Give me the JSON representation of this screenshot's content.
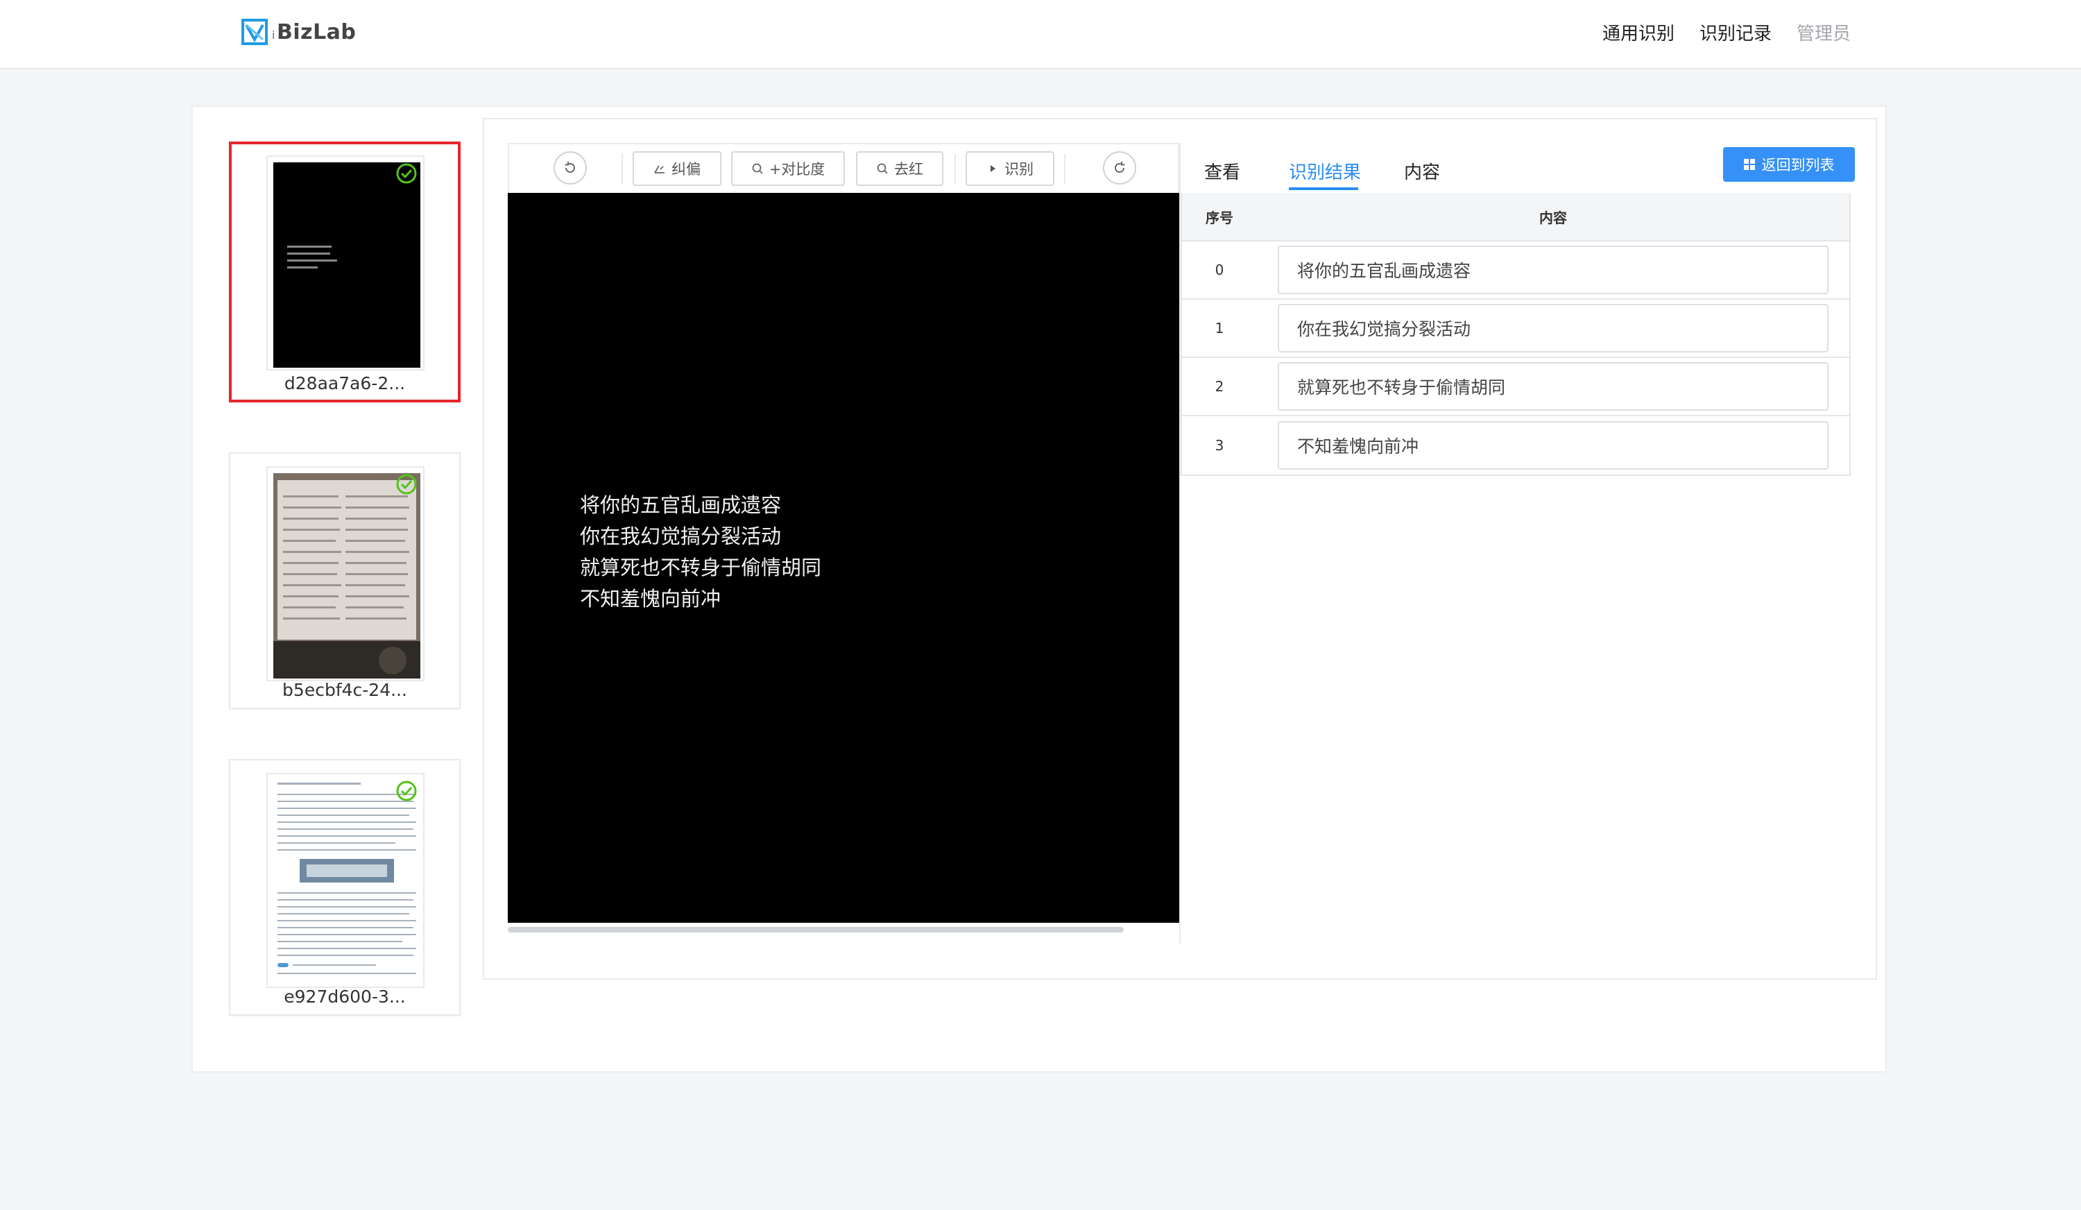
{
  "app": {
    "brand_prefix": "i",
    "brand_name": "BizLab"
  },
  "nav": {
    "items": [
      {
        "label": "通用识别"
      },
      {
        "label": "识别记录"
      },
      {
        "label": "管理员"
      }
    ]
  },
  "thumbnails": [
    {
      "name": "d28aa7a6-2...",
      "selected": true,
      "status_icon": "check-circle-icon"
    },
    {
      "name": "b5ecbf4c-24...",
      "selected": false,
      "status_icon": "check-circle-icon"
    },
    {
      "name": "e927d600-3...",
      "selected": false,
      "status_icon": "check-circle-icon"
    }
  ],
  "toolbar": {
    "deskew_label": "纠偏",
    "contrast_label": "+对比度",
    "remove_red_label": "去红",
    "recognize_label": "识别"
  },
  "image_text": {
    "lines": "将你的五官乱画成遗容\n你在我幻觉搞分裂活动\n就算死也不转身于偷情胡同\n不知羞愧向前冲"
  },
  "tabs": {
    "view": "查看",
    "result": "识别结果",
    "content": "内容",
    "active": "识别结果"
  },
  "back_button_label": "返回到列表",
  "table": {
    "headers": {
      "index": "序号",
      "content": "内容"
    },
    "rows": [
      {
        "index": "0",
        "text": "将你的五官乱画成遗容"
      },
      {
        "index": "1",
        "text": "你在我幻觉搞分裂活动"
      },
      {
        "index": "2",
        "text": "就算死也不转身于偷情胡同"
      },
      {
        "index": "3",
        "text": "不知羞愧向前冲"
      }
    ]
  },
  "colors": {
    "accent": "#2a8df5",
    "button_primary": "#3591f7",
    "selection_border": "#e6262c",
    "status_green": "#52c41a"
  }
}
